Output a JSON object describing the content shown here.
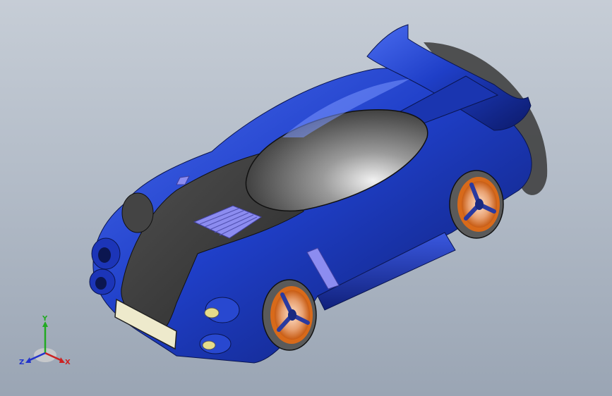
{
  "viewport": {
    "background_top": "#c6cdd6",
    "background_bottom": "#9aa5b4"
  },
  "model": {
    "body_color": "#1f3fc8",
    "body_dark": "#0f1f78",
    "canopy_color": "#3a3a3a",
    "hood_color": "#3b3b3b",
    "vent_color": "#8c8cf0",
    "rim_color": "#d86a1a"
  },
  "triad": {
    "x_label": "X",
    "y_label": "Y",
    "z_label": "Z",
    "x_color": "#cc2222",
    "y_color": "#22aa22",
    "z_color": "#2233cc"
  }
}
